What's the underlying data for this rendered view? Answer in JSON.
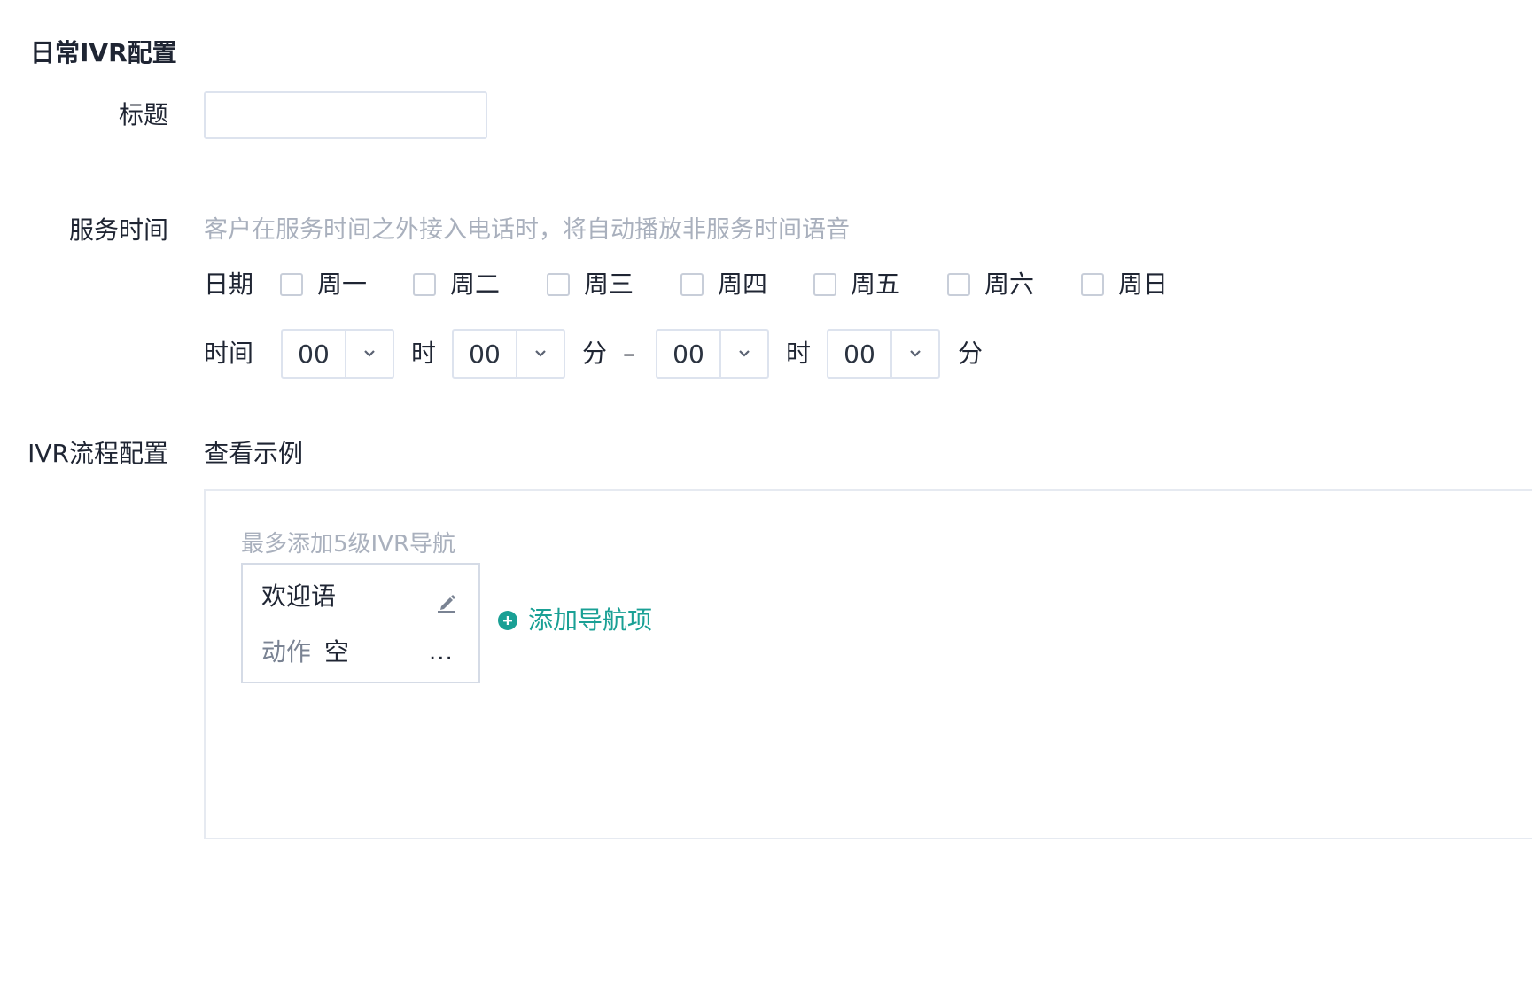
{
  "section": {
    "title": "日常IVR配置"
  },
  "title_field": {
    "label": "标题",
    "value": "",
    "placeholder": ""
  },
  "service_time": {
    "label": "服务时间",
    "hint": "客户在服务时间之外接入电话时，将自动播放非服务时间语音",
    "date_label": "日期",
    "days": [
      {
        "label": "周一",
        "checked": false
      },
      {
        "label": "周二",
        "checked": false
      },
      {
        "label": "周三",
        "checked": false
      },
      {
        "label": "周四",
        "checked": false
      },
      {
        "label": "周五",
        "checked": false
      },
      {
        "label": "周六",
        "checked": false
      },
      {
        "label": "周日",
        "checked": false
      }
    ],
    "time_label": "时间",
    "start_hour": "00",
    "start_minute": "00",
    "end_hour": "00",
    "end_minute": "00",
    "hour_unit": "时",
    "minute_unit": "分",
    "range_separator": "–"
  },
  "ivr_flow": {
    "label": "IVR流程配置",
    "example_link": "查看示例",
    "hint": "最多添加5级IVR导航",
    "card": {
      "title": "欢迎语",
      "action_label": "动作",
      "action_value": "空",
      "more": "...",
      "edit_icon": "pencil-icon"
    },
    "add_nav_label": "添加导航项",
    "add_icon": "plus-circle-icon",
    "accent_color": "#1aa095"
  }
}
